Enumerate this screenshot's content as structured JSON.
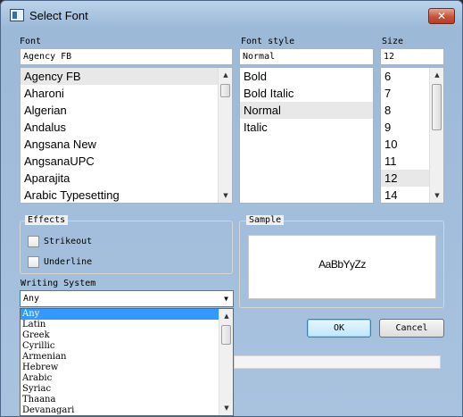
{
  "window": {
    "title": "Select Font",
    "close_glyph": "✕"
  },
  "font": {
    "label": "Font",
    "value": "Agency FB",
    "items": [
      "Agency FB",
      "Aharoni",
      "Algerian",
      "Andalus",
      "Angsana New",
      "AngsanaUPC",
      "Aparajita",
      "Arabic Typesetting"
    ],
    "selected_index": 0
  },
  "style": {
    "label": "Font style",
    "value": "Normal",
    "items": [
      "Bold",
      "Bold Italic",
      "Normal",
      "Italic"
    ],
    "selected_index": 2
  },
  "size": {
    "label": "Size",
    "value": "12",
    "items": [
      "6",
      "7",
      "8",
      "9",
      "10",
      "11",
      "12",
      "14"
    ],
    "selected_index": 6
  },
  "effects": {
    "title": "Effects",
    "strikeout": "Strikeout",
    "underline": "Underline"
  },
  "sample": {
    "title": "Sample",
    "text": "AaBbYyZz"
  },
  "writing_system": {
    "label": "Writing System",
    "value": "Any",
    "options": [
      "Any",
      "Latin",
      "Greek",
      "Cyrillic",
      "Armenian",
      "Hebrew",
      "Arabic",
      "Syriac",
      "Thaana",
      "Devanagari"
    ],
    "selected_index": 0
  },
  "buttons": {
    "ok": "OK",
    "cancel": "Cancel"
  },
  "icons": {
    "scroll_up": "▲",
    "scroll_down": "▼",
    "combo_arrow": "▼"
  }
}
